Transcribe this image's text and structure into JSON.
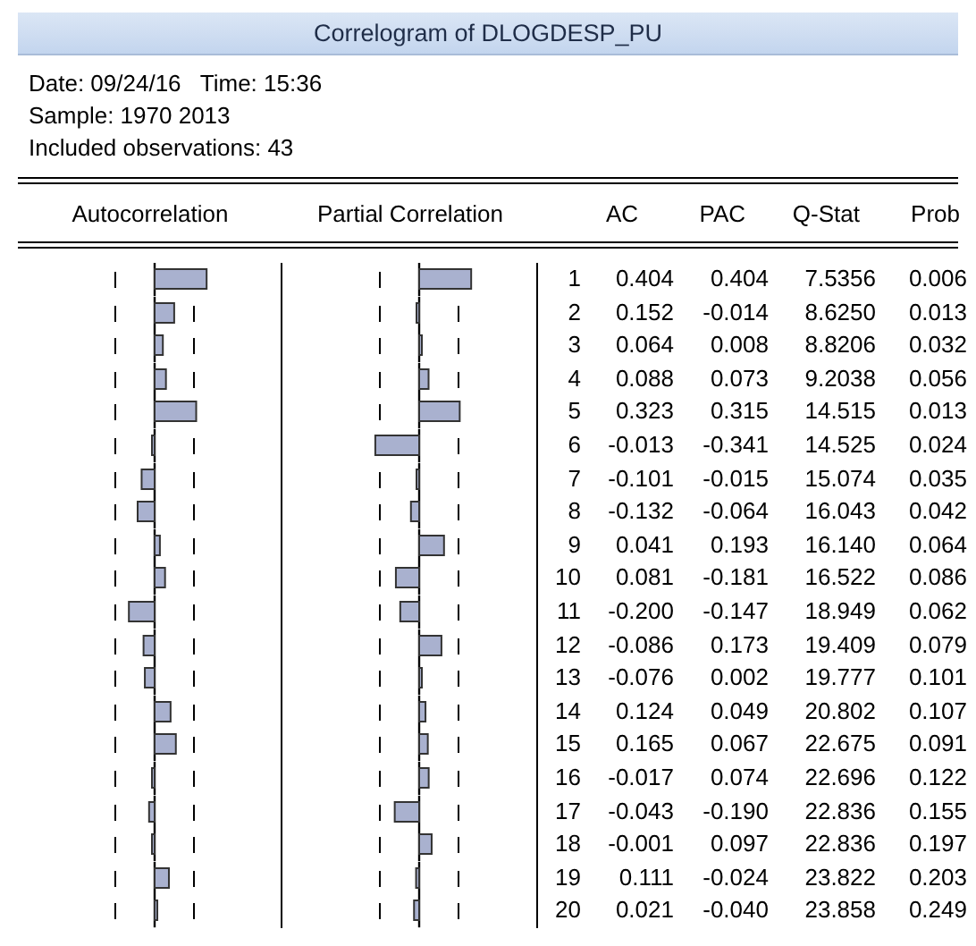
{
  "window": {
    "title": "Correlogram of DLOGDESP_PU"
  },
  "info": [
    "Date: 09/24/16   Time: 15:36",
    "Sample: 1970 2013",
    "Included observations: 43"
  ],
  "table": {
    "columns": [
      "Autocorrelation",
      "Partial Correlation",
      "AC",
      "PAC",
      "Q-Stat",
      "Prob"
    ],
    "rows": [
      {
        "lag": "1",
        "ac": "0.404",
        "pac": "0.404",
        "q_stat": "7.5356",
        "prob": "0.006"
      },
      {
        "lag": "2",
        "ac": "0.152",
        "pac": "-0.014",
        "q_stat": "8.6250",
        "prob": "0.013"
      },
      {
        "lag": "3",
        "ac": "0.064",
        "pac": "0.008",
        "q_stat": "8.8206",
        "prob": "0.032"
      },
      {
        "lag": "4",
        "ac": "0.088",
        "pac": "0.073",
        "q_stat": "9.2038",
        "prob": "0.056"
      },
      {
        "lag": "5",
        "ac": "0.323",
        "pac": "0.315",
        "q_stat": "14.515",
        "prob": "0.013"
      },
      {
        "lag": "6",
        "ac": "-0.013",
        "pac": "-0.341",
        "q_stat": "14.525",
        "prob": "0.024"
      },
      {
        "lag": "7",
        "ac": "-0.101",
        "pac": "-0.015",
        "q_stat": "15.074",
        "prob": "0.035"
      },
      {
        "lag": "8",
        "ac": "-0.132",
        "pac": "-0.064",
        "q_stat": "16.043",
        "prob": "0.042"
      },
      {
        "lag": "9",
        "ac": "0.041",
        "pac": "0.193",
        "q_stat": "16.140",
        "prob": "0.064"
      },
      {
        "lag": "10",
        "ac": "0.081",
        "pac": "-0.181",
        "q_stat": "16.522",
        "prob": "0.086"
      },
      {
        "lag": "11",
        "ac": "-0.200",
        "pac": "-0.147",
        "q_stat": "18.949",
        "prob": "0.062"
      },
      {
        "lag": "12",
        "ac": "-0.086",
        "pac": "0.173",
        "q_stat": "19.409",
        "prob": "0.079"
      },
      {
        "lag": "13",
        "ac": "-0.076",
        "pac": "0.002",
        "q_stat": "19.777",
        "prob": "0.101"
      },
      {
        "lag": "14",
        "ac": "0.124",
        "pac": "0.049",
        "q_stat": "20.802",
        "prob": "0.107"
      },
      {
        "lag": "15",
        "ac": "0.165",
        "pac": "0.067",
        "q_stat": "22.675",
        "prob": "0.091"
      },
      {
        "lag": "16",
        "ac": "-0.017",
        "pac": "0.074",
        "q_stat": "22.696",
        "prob": "0.122"
      },
      {
        "lag": "17",
        "ac": "-0.043",
        "pac": "-0.190",
        "q_stat": "22.836",
        "prob": "0.155"
      },
      {
        "lag": "18",
        "ac": "-0.001",
        "pac": "0.097",
        "q_stat": "22.836",
        "prob": "0.197"
      },
      {
        "lag": "19",
        "ac": "0.111",
        "pac": "-0.024",
        "q_stat": "23.822",
        "prob": "0.203"
      },
      {
        "lag": "20",
        "ac": "0.021",
        "pac": "-0.040",
        "q_stat": "23.858",
        "prob": "0.249"
      }
    ]
  }
}
